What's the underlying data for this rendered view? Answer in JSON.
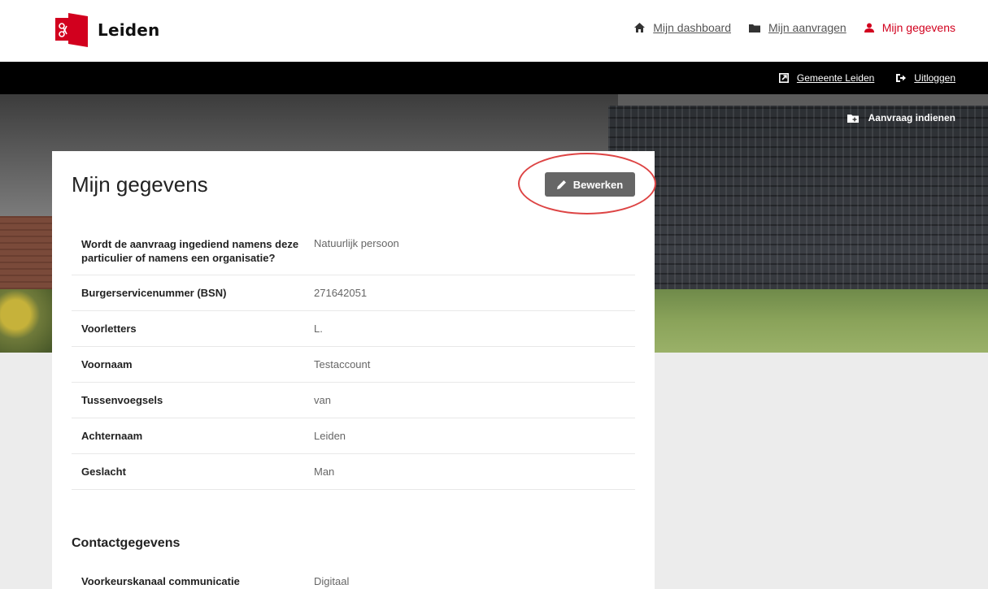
{
  "brand": {
    "name": "Leiden",
    "color": "#d2001e"
  },
  "topnav": [
    {
      "label": "Mijn dashboard",
      "icon": "home-icon"
    },
    {
      "label": "Mijn aanvragen",
      "icon": "folder-icon"
    },
    {
      "label": "Mijn gegevens",
      "icon": "user-icon",
      "active": true
    }
  ],
  "utilnav": [
    {
      "label": "Gemeente Leiden",
      "icon": "external-link-icon"
    },
    {
      "label": "Uitloggen",
      "icon": "logout-icon"
    }
  ],
  "hero": {
    "cta_label": "Aanvraag indienen"
  },
  "card": {
    "title": "Mijn gegevens",
    "edit_label": "Bewerken",
    "fields": [
      {
        "key": "Wordt de aanvraag ingediend namens deze particulier of namens een organisatie?",
        "value": "Natuurlijk persoon"
      },
      {
        "key": "Burgerservicenummer (BSN)",
        "value": "271642051"
      },
      {
        "key": "Voorletters",
        "value": "L."
      },
      {
        "key": "Voornaam",
        "value": "Testaccount"
      },
      {
        "key": "Tussenvoegsels",
        "value": "van"
      },
      {
        "key": "Achternaam",
        "value": "Leiden"
      },
      {
        "key": "Geslacht",
        "value": "Man"
      }
    ],
    "contact_title": "Contactgegevens",
    "contact_fields": [
      {
        "key": "Voorkeurskanaal communicatie",
        "value": "Digitaal"
      }
    ]
  }
}
